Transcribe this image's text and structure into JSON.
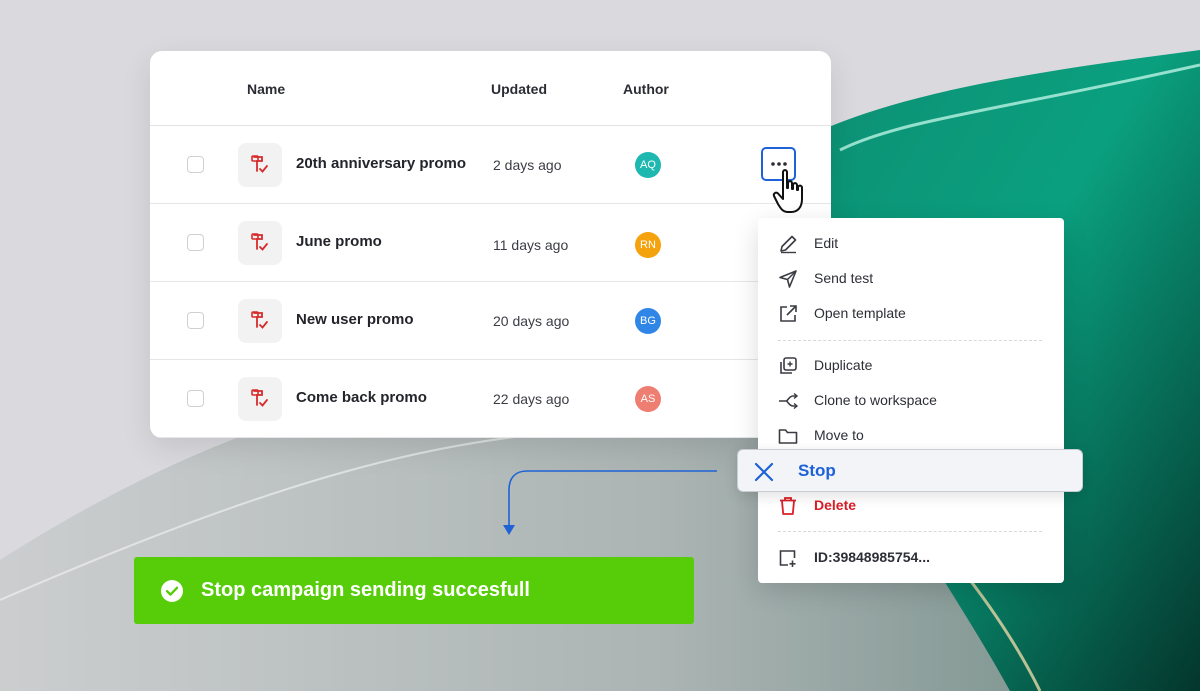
{
  "table": {
    "columns": {
      "name": "Name",
      "updated": "Updated",
      "author": "Author"
    },
    "rows": [
      {
        "name": "20th anniversary promo",
        "updated": "2 days ago",
        "author": "AQ",
        "author_color": "#1fb8b0"
      },
      {
        "name": "June promo",
        "updated": "11 days ago",
        "author": "RN",
        "author_color": "#f4a20d"
      },
      {
        "name": "New user promo",
        "updated": "20 days ago",
        "author": "BG",
        "author_color": "#2f86e6"
      },
      {
        "name": "Come back promo",
        "updated": "22 days ago",
        "author": "AS",
        "author_color": "#ee7d72"
      }
    ]
  },
  "menu": {
    "edit": "Edit",
    "send_test": "Send test",
    "open_template": "Open template",
    "duplicate": "Duplicate",
    "clone": "Clone to workspace",
    "move": "Move to",
    "stop": "Stop",
    "delete": "Delete",
    "id": "ID:39848985754..."
  },
  "toast": {
    "message": "Stop campaign sending succesfull"
  },
  "colors": {
    "accent": "#1f62d6",
    "success": "#57cc09",
    "danger": "#d91f26",
    "campaign_icon": "#d82a2a"
  }
}
